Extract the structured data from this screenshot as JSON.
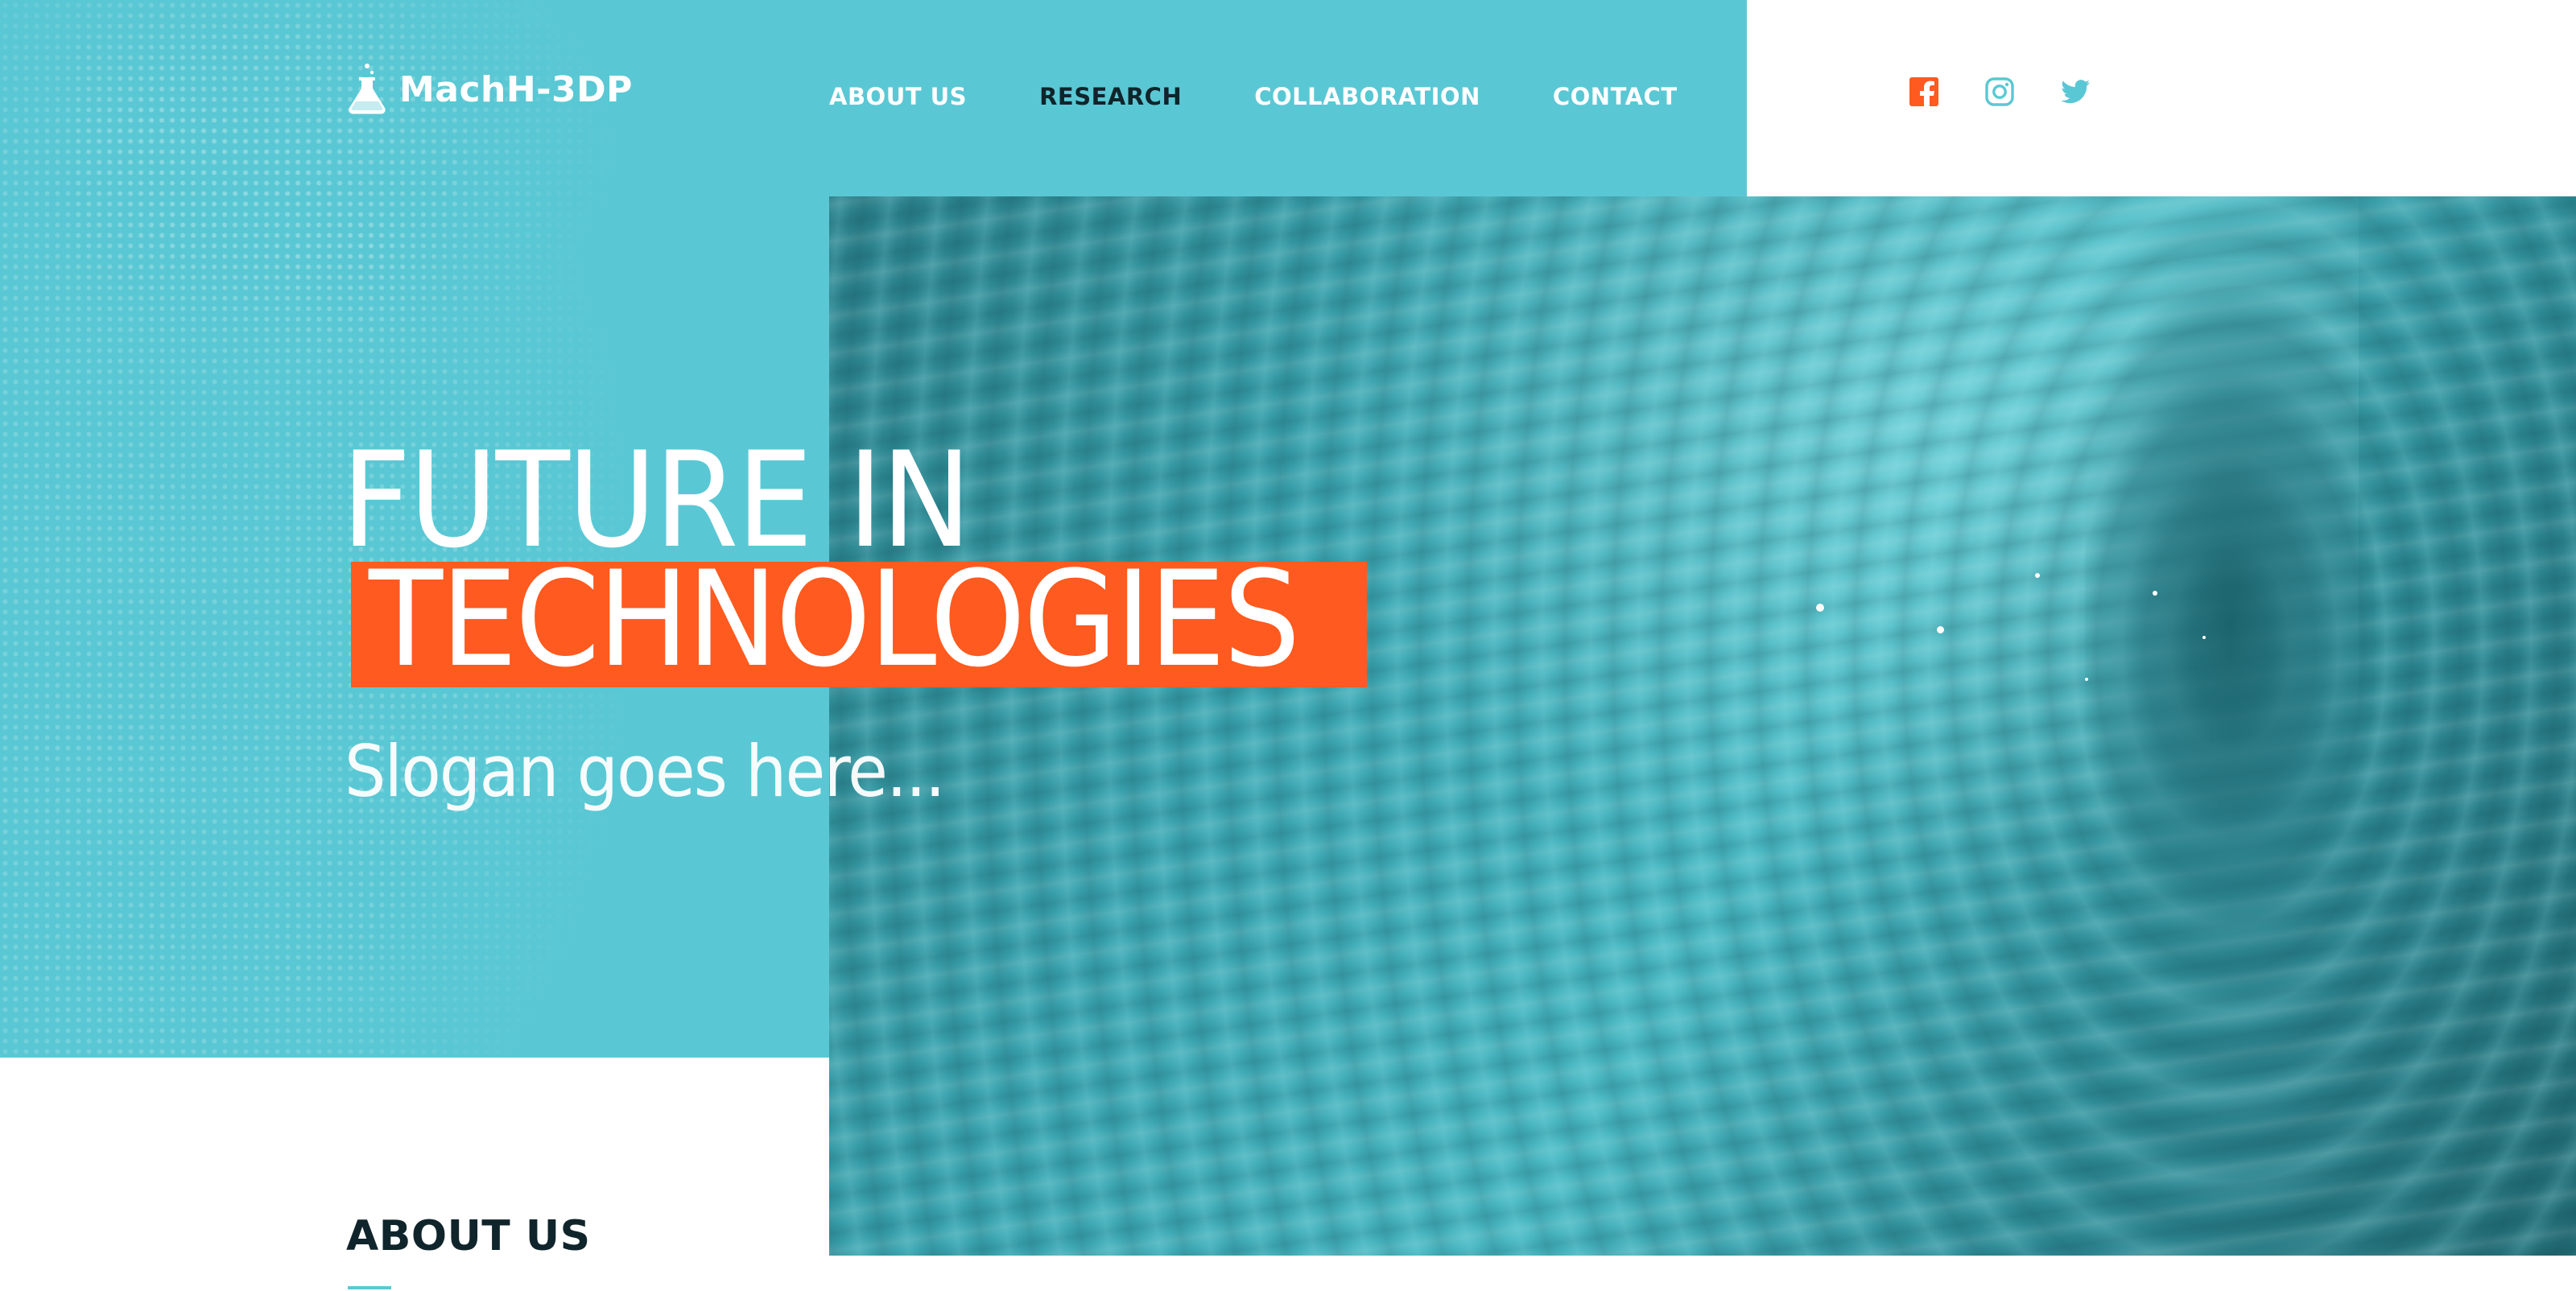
{
  "brand": {
    "name": "MachH-3DP",
    "logo_icon": "flask-icon"
  },
  "nav": {
    "items": [
      {
        "label": "ABOUT US",
        "active": false
      },
      {
        "label": "RESEARCH",
        "active": true
      },
      {
        "label": "COLLABORATION",
        "active": false
      },
      {
        "label": "CONTACT",
        "active": false
      }
    ]
  },
  "social": [
    {
      "icon": "facebook-icon",
      "color": "#ff5a1f"
    },
    {
      "icon": "instagram-icon",
      "color": "#5ac8d4"
    },
    {
      "icon": "twitter-icon",
      "color": "#5ac8d4"
    }
  ],
  "hero": {
    "title_line_1": "FUTURE IN",
    "title_line_2": "TECHNOLOGIES",
    "slogan": "Slogan goes here..."
  },
  "about": {
    "heading": "ABOUT US"
  },
  "colors": {
    "teal": "#5ac8d4",
    "accent_orange": "#ff5a1f",
    "dark_text": "#10242b",
    "white": "#ffffff"
  }
}
